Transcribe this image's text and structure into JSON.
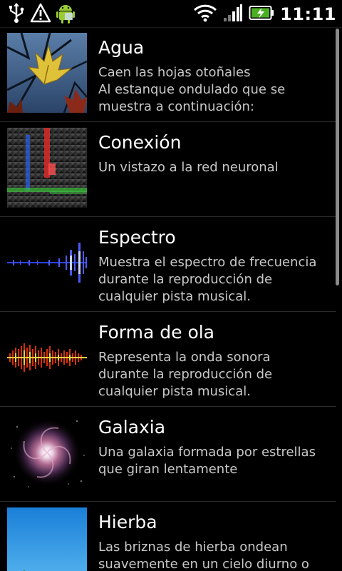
{
  "status_bar": {
    "time": "11:11",
    "icons_left": [
      "usb-icon",
      "warning-icon",
      "android-icon"
    ],
    "icons_right": [
      "wifi-icon",
      "signal-icon",
      "battery-charging-icon"
    ]
  },
  "wallpapers": [
    {
      "title": "Agua",
      "desc_lines": [
        "Caen las hojas otoñales",
        "Al estanque ondulado que se",
        "muestra a continuación:"
      ],
      "thumb": "leaves-thumbnail"
    },
    {
      "title": "Conexión",
      "desc_lines": [
        "Un vistazo a la red neuronal"
      ],
      "thumb": "grid-thumbnail"
    },
    {
      "title": "Espectro",
      "desc_lines": [
        "Muestra el espectro de frecuencia",
        "durante la reproducción de",
        "cualquier pista musical."
      ],
      "thumb": "spectrum-thumbnail"
    },
    {
      "title": "Forma de ola",
      "desc_lines": [
        "Representa la onda sonora",
        "durante la reproducción de",
        "cualquier pista musical."
      ],
      "thumb": "waveform-thumbnail"
    },
    {
      "title": "Galaxia",
      "desc_lines": [
        "Una galaxia formada por estrellas",
        "que giran lentamente"
      ],
      "thumb": "galaxy-thumbnail"
    },
    {
      "title": "Hierba",
      "desc_lines": [
        "Las briznas de hierba ondean",
        "suavemente en un cielo diurno o"
      ],
      "thumb": "sky-grass-thumbnail"
    }
  ],
  "colors": {
    "background": "#000000",
    "title": "#ffffff",
    "description": "#c8c8c8",
    "divider": "#2b2b2b"
  }
}
